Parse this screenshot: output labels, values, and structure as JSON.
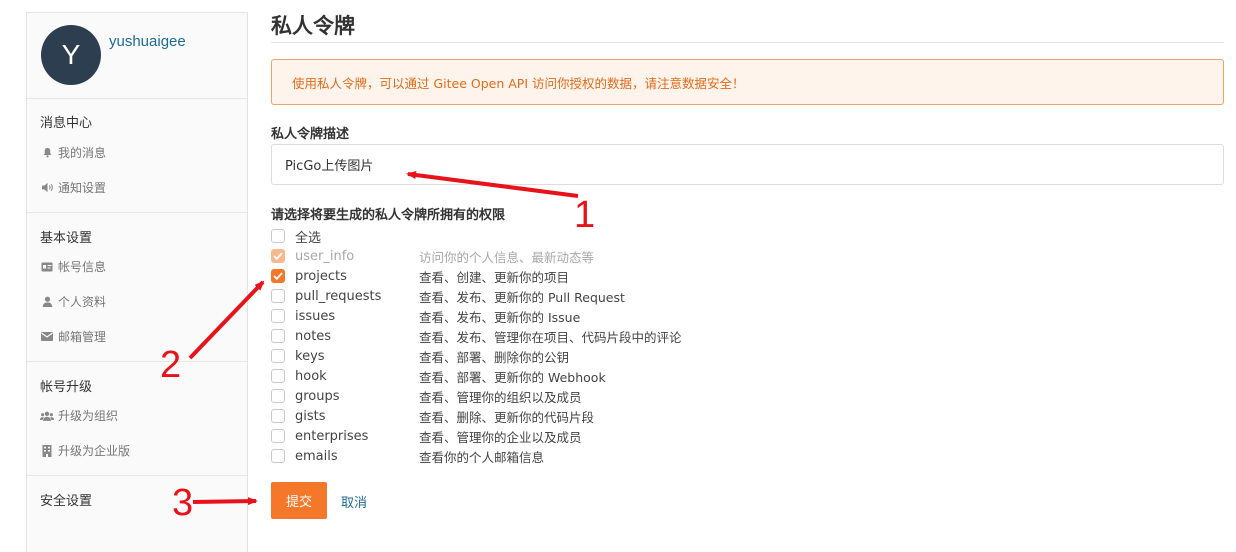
{
  "sidebar": {
    "avatar_letter": "Y",
    "username": "yushuaigee",
    "groups": [
      {
        "heading": "消息中心",
        "items": [
          {
            "label": "我的消息",
            "icon": "bell-icon"
          },
          {
            "label": "通知设置",
            "icon": "volume-icon"
          }
        ]
      },
      {
        "heading": "基本设置",
        "items": [
          {
            "label": "帐号信息",
            "icon": "id-card-icon"
          },
          {
            "label": "个人资料",
            "icon": "user-icon"
          },
          {
            "label": "邮箱管理",
            "icon": "envelope-icon"
          }
        ]
      },
      {
        "heading": "帐号升级",
        "items": [
          {
            "label": "升级为组织",
            "icon": "users-icon"
          },
          {
            "label": "升级为企业版",
            "icon": "building-icon"
          }
        ]
      },
      {
        "heading": "安全设置"
      }
    ]
  },
  "main": {
    "title": "私人令牌",
    "alert": "使用私人令牌，可以通过 Gitee Open API 访问你授权的数据，请注意数据安全！",
    "desc_label": "私人令牌描述",
    "desc_value": "PicGo上传图片",
    "perm_label": "请选择将要生成的私人令牌所拥有的权限",
    "select_all": "全选",
    "permissions": [
      {
        "name": "user_info",
        "desc": "访问你的个人信息、最新动态等",
        "checked": true,
        "disabled": true
      },
      {
        "name": "projects",
        "desc": "查看、创建、更新你的项目",
        "checked": true,
        "disabled": false
      },
      {
        "name": "pull_requests",
        "desc": "查看、发布、更新你的 Pull Request",
        "checked": false,
        "disabled": false
      },
      {
        "name": "issues",
        "desc": "查看、发布、更新你的 Issue",
        "checked": false,
        "disabled": false
      },
      {
        "name": "notes",
        "desc": "查看、发布、管理你在项目、代码片段中的评论",
        "checked": false,
        "disabled": false
      },
      {
        "name": "keys",
        "desc": "查看、部署、删除你的公钥",
        "checked": false,
        "disabled": false
      },
      {
        "name": "hook",
        "desc": "查看、部署、更新你的 Webhook",
        "checked": false,
        "disabled": false
      },
      {
        "name": "groups",
        "desc": "查看、管理你的组织以及成员",
        "checked": false,
        "disabled": false
      },
      {
        "name": "gists",
        "desc": "查看、删除、更新你的代码片段",
        "checked": false,
        "disabled": false
      },
      {
        "name": "enterprises",
        "desc": "查看、管理你的企业以及成员",
        "checked": false,
        "disabled": false
      },
      {
        "name": "emails",
        "desc": "查看你的个人邮箱信息",
        "checked": false,
        "disabled": false
      }
    ],
    "submit_label": "提交",
    "cancel_label": "取消"
  },
  "annotations": [
    "1",
    "2",
    "3"
  ],
  "colors": {
    "accent": "#f5782a",
    "link": "#1e6a9a",
    "annotation": "#e8121b"
  }
}
